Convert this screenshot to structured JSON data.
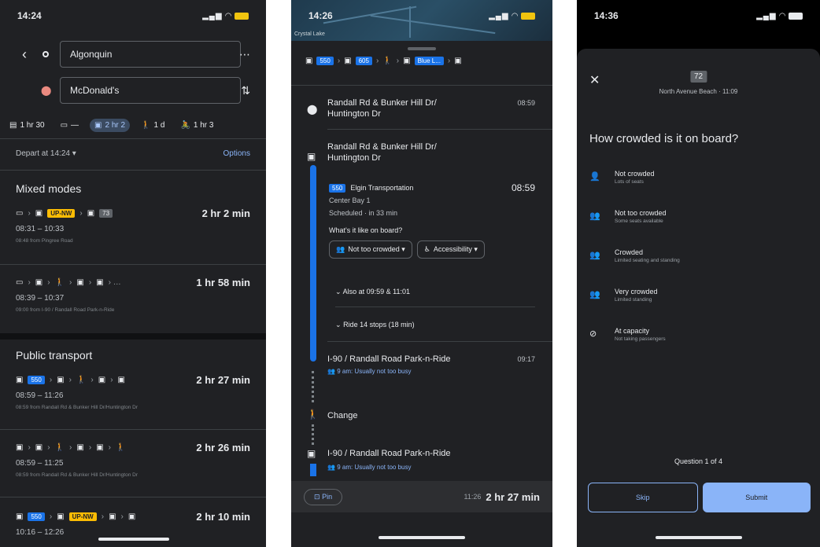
{
  "panel1": {
    "status": {
      "time": "14:24",
      "icons": "signal-wifi-battery"
    },
    "origin": "Algonquin",
    "destination": "McDonald's",
    "modes": [
      {
        "icon": "transit-icon",
        "label": "1 hr 30"
      },
      {
        "icon": "car-icon",
        "label": "—"
      },
      {
        "icon": "bus-icon",
        "label": "2 hr 2"
      },
      {
        "icon": "walk-icon",
        "label": "1 d"
      },
      {
        "icon": "bike-icon",
        "label": "1 hr 3"
      }
    ],
    "depart": "Depart at 14:24 ▾",
    "options": "Options",
    "mixed_title": "Mixed modes",
    "public_title": "Public transport",
    "mixed_routes": [
      {
        "chips": [
          "🚗",
          "›",
          "🚆",
          "UP-NW",
          "›",
          "🚌",
          "73"
        ],
        "duration": "2 hr 2 min",
        "times": "08:31 – 10:33",
        "from": "08:48 from Pingree Road"
      },
      {
        "chips": [
          "🚗",
          "›",
          "🚌",
          "›",
          "🚶",
          "›",
          "🚆",
          "›",
          "🚆",
          "›",
          "…"
        ],
        "duration": "1 hr 58 min",
        "times": "08:39 – 10:37",
        "from": "09:00 from I-90 / Randall Road Park-n-Ride"
      }
    ],
    "public_routes": [
      {
        "chips": [
          "🚌",
          "550",
          "›",
          "🚌",
          "›",
          "🚶",
          "›",
          "🚆",
          "›",
          "🚌"
        ],
        "duration": "2 hr 27 min",
        "times": "08:59 – 11:26",
        "from": "08:59 from Randall Rd & Bunker Hill Dr/Huntington Dr"
      },
      {
        "chips": [
          "🚌",
          "›",
          "🚌",
          "›",
          "🚶",
          "›",
          "🚆",
          "›",
          "🚆",
          "›",
          "🚶"
        ],
        "duration": "2 hr 26 min",
        "times": "08:59 – 11:25",
        "from": "08:59 from Randall Rd & Bunker Hill Dr/Huntington Dr"
      },
      {
        "chips": [
          "🚌",
          "550",
          "›",
          "🚆",
          "UP-NW",
          "›",
          "🚌",
          "›",
          "🚌"
        ],
        "duration": "2 hr 10 min",
        "times": "10:16 – 12:26",
        "from": ""
      }
    ]
  },
  "panel2": {
    "status": {
      "time": "14:26"
    },
    "map_label": "Crystal Lake",
    "chain": [
      "🚌",
      "550",
      "›",
      "🚌",
      "605",
      "›",
      "🚶",
      "›",
      "🚆",
      "Blue L...",
      "›",
      "🚌"
    ],
    "stop1": {
      "name": "Randall Rd & Bunker Hill Dr/ Huntington Dr",
      "time": "08:59"
    },
    "stop2": {
      "name": "Randall Rd & Bunker Hill Dr/ Huntington Dr"
    },
    "bus": {
      "route": "550",
      "agency": "Elgin Transportation",
      "bay": "Center Bay 1",
      "scheduled": "Scheduled · in 33 min",
      "time": "08:59"
    },
    "onboard_q": "What's it like on board?",
    "btn_crowd": "Not too crowded ▾",
    "btn_access": "Accessibility ▾",
    "also_at": "Also at 09:59 & 11:01",
    "ride": "Ride 14 stops (18 min)",
    "stop3": {
      "name": "I-90 / Randall Road Park-n-Ride",
      "time": "09:17",
      "busy": "9 am: Usually not too busy"
    },
    "change": "Change",
    "stop4": {
      "name": "I-90 / Randall Road Park-n-Ride",
      "busy": "9 am: Usually not too busy"
    },
    "pin": "Pin",
    "eta": "11:26",
    "total": "2 hr 27 min"
  },
  "panel3": {
    "status": {
      "time": "14:36"
    },
    "route_badge": "72",
    "route_dest": "North Avenue Beach · 11:09",
    "question": "How crowded is it on board?",
    "options": [
      {
        "label": "Not crowded",
        "sub": "Lots of seats"
      },
      {
        "label": "Not too crowded",
        "sub": "Some seats available"
      },
      {
        "label": "Crowded",
        "sub": "Limited seating and standing"
      },
      {
        "label": "Very crowded",
        "sub": "Limited standing"
      },
      {
        "label": "At capacity",
        "sub": "Not taking passengers"
      }
    ],
    "question_count": "Question 1 of 4",
    "skip": "Skip",
    "submit": "Submit"
  }
}
